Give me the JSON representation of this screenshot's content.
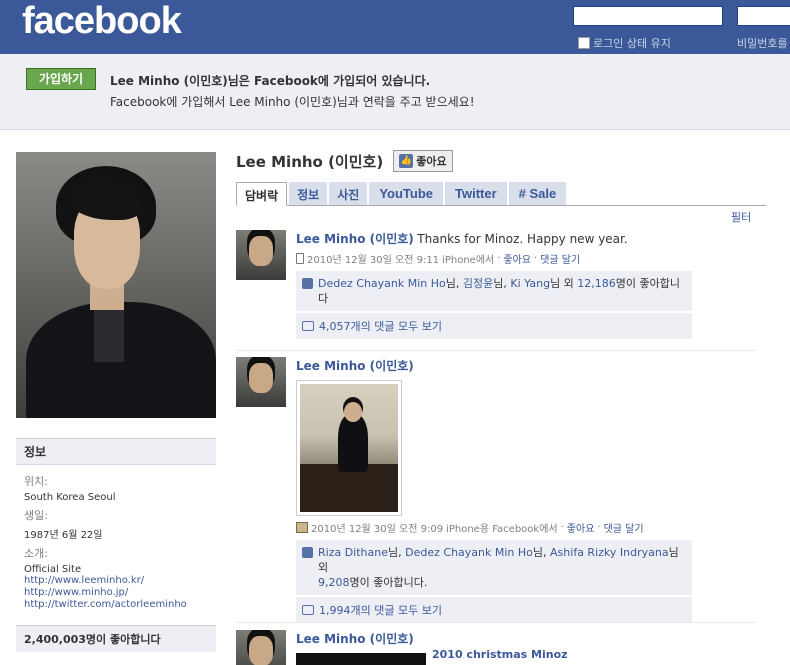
{
  "header": {
    "logo": "facebook",
    "remember_label": "로그인 상태 유지",
    "forgot_label": "비밀번호를"
  },
  "join": {
    "button": "가입하기",
    "title": "Lee Minho (이민호)님은 Facebook에 가입되어 있습니다.",
    "subtitle": "Facebook에 가입해서 Lee Minho (이민호)님과 연락을 주고 받으세요!"
  },
  "profile": {
    "name": "Lee Minho (이민호)",
    "like_button": "좋아요",
    "tabs": [
      "담벼락",
      "정보",
      "사진",
      "YouTube",
      "Twitter",
      "# Sale"
    ],
    "filter": "필터"
  },
  "info": {
    "heading": "정보",
    "location_label": "위치:",
    "location_value": "South Korea Seoul",
    "birthday_label": "생일:",
    "birthday_value": "1987년 6월 22일",
    "about_label": "소개:",
    "official_site": "Official Site",
    "links": [
      "http://www.leeminho.kr/",
      "http://www.minho.jp/",
      "http://twitter.com/actorleeminho"
    ],
    "likes_total": "2,400,003명이 좋아합니다"
  },
  "posts": [
    {
      "author": "Lee Minho (이민호)",
      "message": "Thanks for Minoz. Happy new year.",
      "time": "2010년 12월 30일 오전 9:11",
      "via": "iPhone에서",
      "like_action": "좋아요",
      "comment_action": "댓글 달기",
      "likers": [
        "Dedez Chayank Min Ho",
        "김정윤",
        "Ki Yang"
      ],
      "liker_suffixes": [
        "님, ",
        "님, ",
        "님 외 "
      ],
      "like_count": "12,186",
      "like_tail": "명이 좋아합니다",
      "comments_link": "4,057개의 댓글 모두 보기"
    },
    {
      "author": "Lee Minho (이민호)",
      "time": "2010년 12월 30일 오전 9:09",
      "via": "iPhone용 Facebook에서",
      "like_action": "좋아요",
      "comment_action": "댓글 달기",
      "likers": [
        "Riza Dithane",
        "Dedez Chayank Min Ho",
        "Ashifa Rizky Indryana"
      ],
      "liker_suffixes": [
        "님, ",
        "님, ",
        "님 외"
      ],
      "like_count": "9,208",
      "like_tail": "명이 좋아합니다.",
      "comments_link": "1,994개의 댓글 모두 보기"
    },
    {
      "author": "Lee Minho (이민호)",
      "attachment_title": "2010 christmas Minoz"
    }
  ],
  "sep": " · "
}
